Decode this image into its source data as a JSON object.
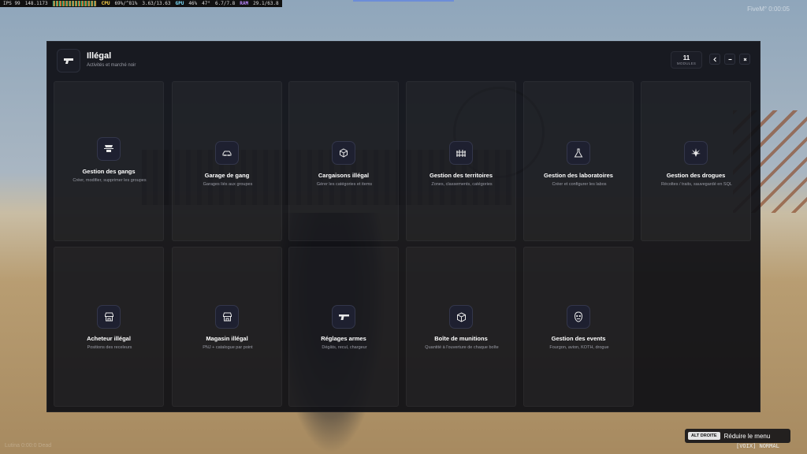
{
  "hud": {
    "ips": "IPS 99",
    "ips_sub": "148.1173",
    "cpu_label": "CPU",
    "cpu_value": "69%/^81%",
    "cpu_temp": "3.63/13.63",
    "gpu_label": "GPU",
    "gpu_value": "46%",
    "gpu_temp": "47°",
    "gpu_mem": "6.7/7.8",
    "ram_label": "RAM",
    "ram_value": "29.1/63.8"
  },
  "overlay": {
    "fivem_text": "FiveM° 0:00:05"
  },
  "header": {
    "title": "Illégal",
    "subtitle": "Activités et marché noir",
    "icon": "pistol-icon",
    "module_count": "11",
    "module_unit": "MODULES"
  },
  "modules": [
    {
      "title": "Gestion des gangs",
      "desc": "Créer, modifier, supprimer les groupes",
      "icon": "gang-hat-icon"
    },
    {
      "title": "Garage de gang",
      "desc": "Garages liés aux groupes",
      "icon": "car-icon"
    },
    {
      "title": "Cargaisons illégal",
      "desc": "Gérer les catégories et items",
      "icon": "package-icon"
    },
    {
      "title": "Gestion des territoires",
      "desc": "Zones, classements, catégories",
      "icon": "fence-icon"
    },
    {
      "title": "Gestion des laboratoires",
      "desc": "Créer et configurer les labos",
      "icon": "flask-icon"
    },
    {
      "title": "Gestion des drogues",
      "desc": "Récoltes / traits, sauvegardé en SQL",
      "icon": "leaf-icon"
    },
    {
      "title": "Acheteur illégal",
      "desc": "Positions des receleurs",
      "icon": "store-icon"
    },
    {
      "title": "Magasin illégal",
      "desc": "PNJ + catalogue par point",
      "icon": "shop-icon"
    },
    {
      "title": "Réglages armes",
      "desc": "Dégâts, recul, chargeur",
      "icon": "gun-icon"
    },
    {
      "title": "Boîte de munitions",
      "desc": "Quantité à l'ouverture de chaque boîte",
      "icon": "ammo-box-icon"
    },
    {
      "title": "Gestion des events",
      "desc": "Fourgon, avion, KOTH, drogue",
      "icon": "mask-icon"
    }
  ],
  "hint": {
    "key": "ALT DROITE",
    "text": "Réduire le menu"
  },
  "voice": "[VOIX] NORMAL",
  "faint": "Lutina 0:00:0 Dead"
}
